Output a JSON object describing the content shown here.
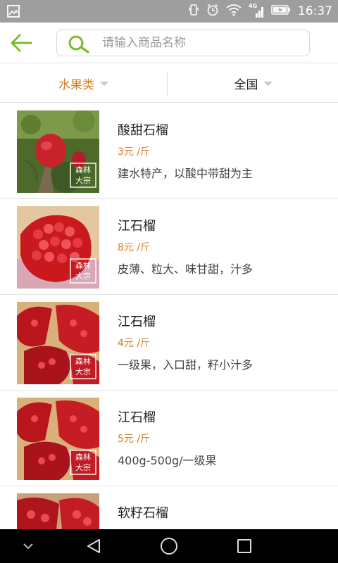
{
  "status_bar": {
    "time": "16:37",
    "network": "4G"
  },
  "header": {
    "back_icon": "arrow-left-icon",
    "search_icon": "search-icon",
    "search_placeholder": "请输入商品名称",
    "accent_color": "#7dbb2c"
  },
  "filters": {
    "category": "水果类",
    "region": "全国",
    "active_color": "#d97a1c"
  },
  "watermark": {
    "text": "森林大宗"
  },
  "products": [
    {
      "name": "酸甜石榴",
      "price": "3元 /斤",
      "description": "建水特产，以酸中带甜为主"
    },
    {
      "name": "江石榴",
      "price": "8元 /斤",
      "description": "皮薄、粒大、味甘甜，汁多"
    },
    {
      "name": "江石榴",
      "price": "4元 /斤",
      "description": "一级果，入口甜，籽小汁多"
    },
    {
      "name": "江石榴",
      "price": "5元 /斤",
      "description": "400g-500g/一级果"
    },
    {
      "name": "软籽石榴",
      "price": "",
      "description": ""
    }
  ],
  "nav_bar": {
    "items": [
      "chevron-down-icon",
      "back-triangle-icon",
      "home-circle-icon",
      "recents-square-icon"
    ]
  }
}
